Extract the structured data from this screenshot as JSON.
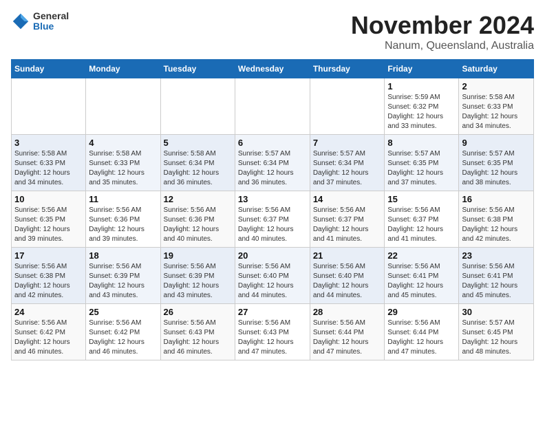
{
  "logo": {
    "general": "General",
    "blue": "Blue"
  },
  "title": "November 2024",
  "location": "Nanum, Queensland, Australia",
  "days_of_week": [
    "Sunday",
    "Monday",
    "Tuesday",
    "Wednesday",
    "Thursday",
    "Friday",
    "Saturday"
  ],
  "weeks": [
    [
      {
        "day": "",
        "sunrise": "",
        "sunset": "",
        "daylight": ""
      },
      {
        "day": "",
        "sunrise": "",
        "sunset": "",
        "daylight": ""
      },
      {
        "day": "",
        "sunrise": "",
        "sunset": "",
        "daylight": ""
      },
      {
        "day": "",
        "sunrise": "",
        "sunset": "",
        "daylight": ""
      },
      {
        "day": "",
        "sunrise": "",
        "sunset": "",
        "daylight": ""
      },
      {
        "day": "1",
        "sunrise": "Sunrise: 5:59 AM",
        "sunset": "Sunset: 6:32 PM",
        "daylight": "Daylight: 12 hours and 33 minutes."
      },
      {
        "day": "2",
        "sunrise": "Sunrise: 5:58 AM",
        "sunset": "Sunset: 6:33 PM",
        "daylight": "Daylight: 12 hours and 34 minutes."
      }
    ],
    [
      {
        "day": "3",
        "sunrise": "Sunrise: 5:58 AM",
        "sunset": "Sunset: 6:33 PM",
        "daylight": "Daylight: 12 hours and 34 minutes."
      },
      {
        "day": "4",
        "sunrise": "Sunrise: 5:58 AM",
        "sunset": "Sunset: 6:33 PM",
        "daylight": "Daylight: 12 hours and 35 minutes."
      },
      {
        "day": "5",
        "sunrise": "Sunrise: 5:58 AM",
        "sunset": "Sunset: 6:34 PM",
        "daylight": "Daylight: 12 hours and 36 minutes."
      },
      {
        "day": "6",
        "sunrise": "Sunrise: 5:57 AM",
        "sunset": "Sunset: 6:34 PM",
        "daylight": "Daylight: 12 hours and 36 minutes."
      },
      {
        "day": "7",
        "sunrise": "Sunrise: 5:57 AM",
        "sunset": "Sunset: 6:34 PM",
        "daylight": "Daylight: 12 hours and 37 minutes."
      },
      {
        "day": "8",
        "sunrise": "Sunrise: 5:57 AM",
        "sunset": "Sunset: 6:35 PM",
        "daylight": "Daylight: 12 hours and 37 minutes."
      },
      {
        "day": "9",
        "sunrise": "Sunrise: 5:57 AM",
        "sunset": "Sunset: 6:35 PM",
        "daylight": "Daylight: 12 hours and 38 minutes."
      }
    ],
    [
      {
        "day": "10",
        "sunrise": "Sunrise: 5:56 AM",
        "sunset": "Sunset: 6:35 PM",
        "daylight": "Daylight: 12 hours and 39 minutes."
      },
      {
        "day": "11",
        "sunrise": "Sunrise: 5:56 AM",
        "sunset": "Sunset: 6:36 PM",
        "daylight": "Daylight: 12 hours and 39 minutes."
      },
      {
        "day": "12",
        "sunrise": "Sunrise: 5:56 AM",
        "sunset": "Sunset: 6:36 PM",
        "daylight": "Daylight: 12 hours and 40 minutes."
      },
      {
        "day": "13",
        "sunrise": "Sunrise: 5:56 AM",
        "sunset": "Sunset: 6:37 PM",
        "daylight": "Daylight: 12 hours and 40 minutes."
      },
      {
        "day": "14",
        "sunrise": "Sunrise: 5:56 AM",
        "sunset": "Sunset: 6:37 PM",
        "daylight": "Daylight: 12 hours and 41 minutes."
      },
      {
        "day": "15",
        "sunrise": "Sunrise: 5:56 AM",
        "sunset": "Sunset: 6:37 PM",
        "daylight": "Daylight: 12 hours and 41 minutes."
      },
      {
        "day": "16",
        "sunrise": "Sunrise: 5:56 AM",
        "sunset": "Sunset: 6:38 PM",
        "daylight": "Daylight: 12 hours and 42 minutes."
      }
    ],
    [
      {
        "day": "17",
        "sunrise": "Sunrise: 5:56 AM",
        "sunset": "Sunset: 6:38 PM",
        "daylight": "Daylight: 12 hours and 42 minutes."
      },
      {
        "day": "18",
        "sunrise": "Sunrise: 5:56 AM",
        "sunset": "Sunset: 6:39 PM",
        "daylight": "Daylight: 12 hours and 43 minutes."
      },
      {
        "day": "19",
        "sunrise": "Sunrise: 5:56 AM",
        "sunset": "Sunset: 6:39 PM",
        "daylight": "Daylight: 12 hours and 43 minutes."
      },
      {
        "day": "20",
        "sunrise": "Sunrise: 5:56 AM",
        "sunset": "Sunset: 6:40 PM",
        "daylight": "Daylight: 12 hours and 44 minutes."
      },
      {
        "day": "21",
        "sunrise": "Sunrise: 5:56 AM",
        "sunset": "Sunset: 6:40 PM",
        "daylight": "Daylight: 12 hours and 44 minutes."
      },
      {
        "day": "22",
        "sunrise": "Sunrise: 5:56 AM",
        "sunset": "Sunset: 6:41 PM",
        "daylight": "Daylight: 12 hours and 45 minutes."
      },
      {
        "day": "23",
        "sunrise": "Sunrise: 5:56 AM",
        "sunset": "Sunset: 6:41 PM",
        "daylight": "Daylight: 12 hours and 45 minutes."
      }
    ],
    [
      {
        "day": "24",
        "sunrise": "Sunrise: 5:56 AM",
        "sunset": "Sunset: 6:42 PM",
        "daylight": "Daylight: 12 hours and 46 minutes."
      },
      {
        "day": "25",
        "sunrise": "Sunrise: 5:56 AM",
        "sunset": "Sunset: 6:42 PM",
        "daylight": "Daylight: 12 hours and 46 minutes."
      },
      {
        "day": "26",
        "sunrise": "Sunrise: 5:56 AM",
        "sunset": "Sunset: 6:43 PM",
        "daylight": "Daylight: 12 hours and 46 minutes."
      },
      {
        "day": "27",
        "sunrise": "Sunrise: 5:56 AM",
        "sunset": "Sunset: 6:43 PM",
        "daylight": "Daylight: 12 hours and 47 minutes."
      },
      {
        "day": "28",
        "sunrise": "Sunrise: 5:56 AM",
        "sunset": "Sunset: 6:44 PM",
        "daylight": "Daylight: 12 hours and 47 minutes."
      },
      {
        "day": "29",
        "sunrise": "Sunrise: 5:56 AM",
        "sunset": "Sunset: 6:44 PM",
        "daylight": "Daylight: 12 hours and 47 minutes."
      },
      {
        "day": "30",
        "sunrise": "Sunrise: 5:57 AM",
        "sunset": "Sunset: 6:45 PM",
        "daylight": "Daylight: 12 hours and 48 minutes."
      }
    ]
  ]
}
